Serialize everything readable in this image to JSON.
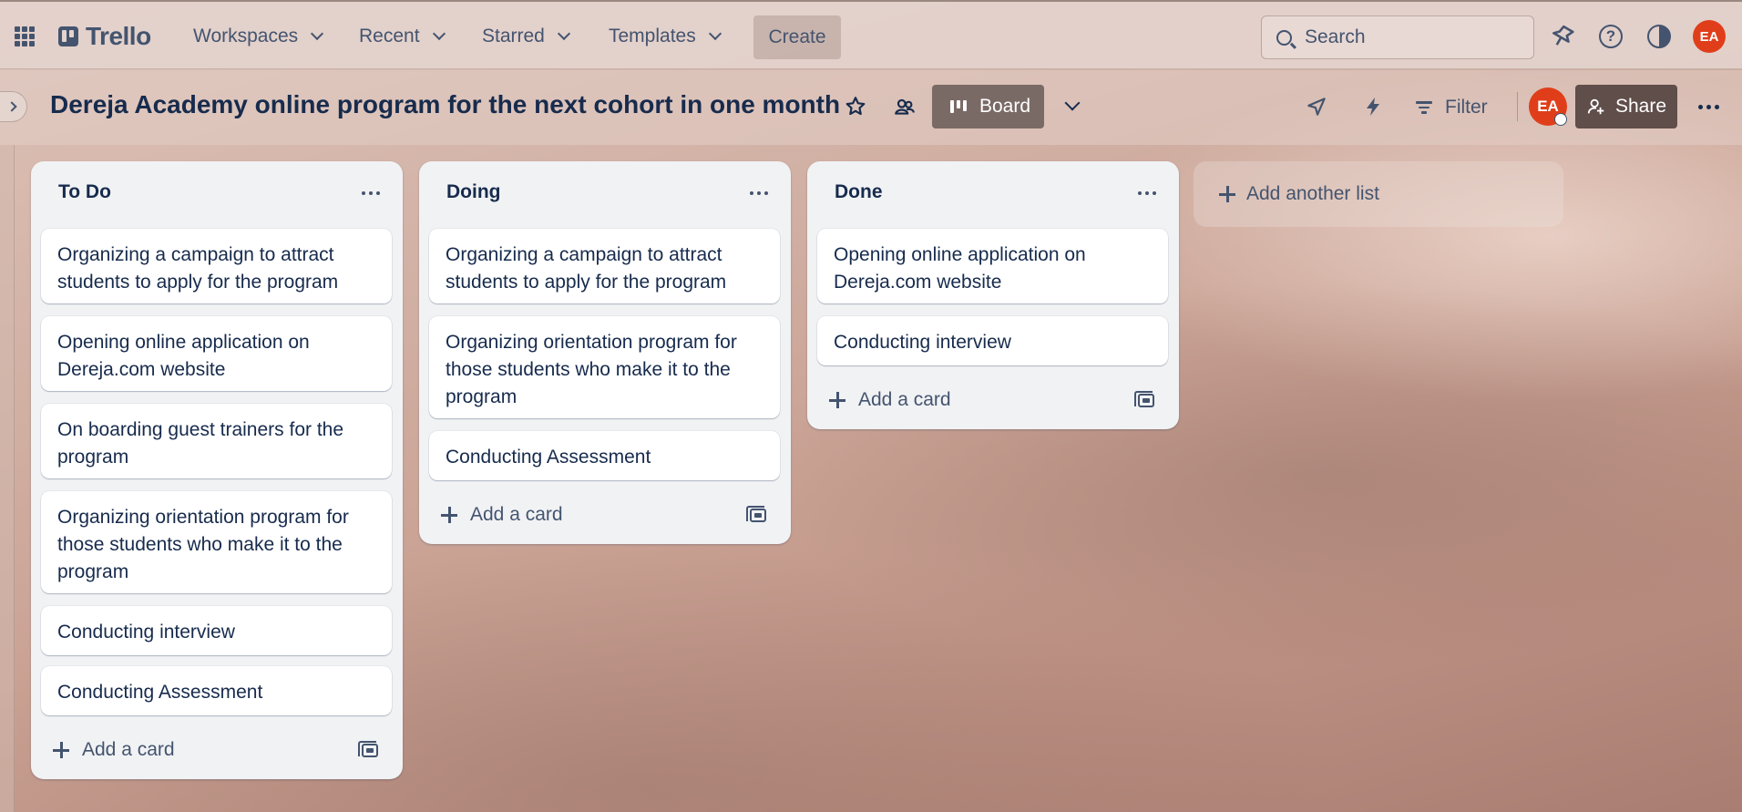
{
  "topbar": {
    "logo_text": "Trello",
    "nav": [
      {
        "label": "Workspaces"
      },
      {
        "label": "Recent"
      },
      {
        "label": "Starred"
      },
      {
        "label": "Templates"
      }
    ],
    "create_label": "Create",
    "search_placeholder": "Search",
    "icons": [
      "apps-grid-icon",
      "notifications-icon",
      "help-icon",
      "theme-icon"
    ],
    "avatar_initials": "EA"
  },
  "board": {
    "title": "Dereja Academy online program for the next cohort in one month",
    "view_label": "Board",
    "filter_label": "Filter",
    "share_label": "Share",
    "member_initials": "EA",
    "icons": [
      "star-icon",
      "workspace-visibility-icon",
      "board-view-icon",
      "power-ups-icon",
      "automation-icon",
      "filter-icon",
      "more-icon"
    ]
  },
  "lists": [
    {
      "name": "To Do",
      "cards": [
        "Organizing a campaign to attract students to apply for the program",
        "Opening online application on Dereja.com website",
        "On boarding guest trainers for the program",
        "Organizing orientation program for those students who make it to the program",
        "Conducting interview",
        "Conducting Assessment"
      ],
      "add_card_label": "Add a card"
    },
    {
      "name": "Doing",
      "cards": [
        "Organizing a campaign to attract students to apply for the program",
        "Organizing orientation program for those students who make it to the program",
        "Conducting Assessment"
      ],
      "add_card_label": "Add a card"
    },
    {
      "name": "Done",
      "cards": [
        "Opening online application on Dereja.com website",
        "Conducting interview"
      ],
      "add_card_label": "Add a card"
    }
  ],
  "add_list_label": "Add another list",
  "colors": {
    "avatar": "#e03e1a",
    "share_button": "#5f4e4a",
    "board_view_button": "#7a6a66",
    "list_background": "#f1f2f4",
    "text_primary": "#172b4d",
    "text_secondary": "#44546f"
  }
}
